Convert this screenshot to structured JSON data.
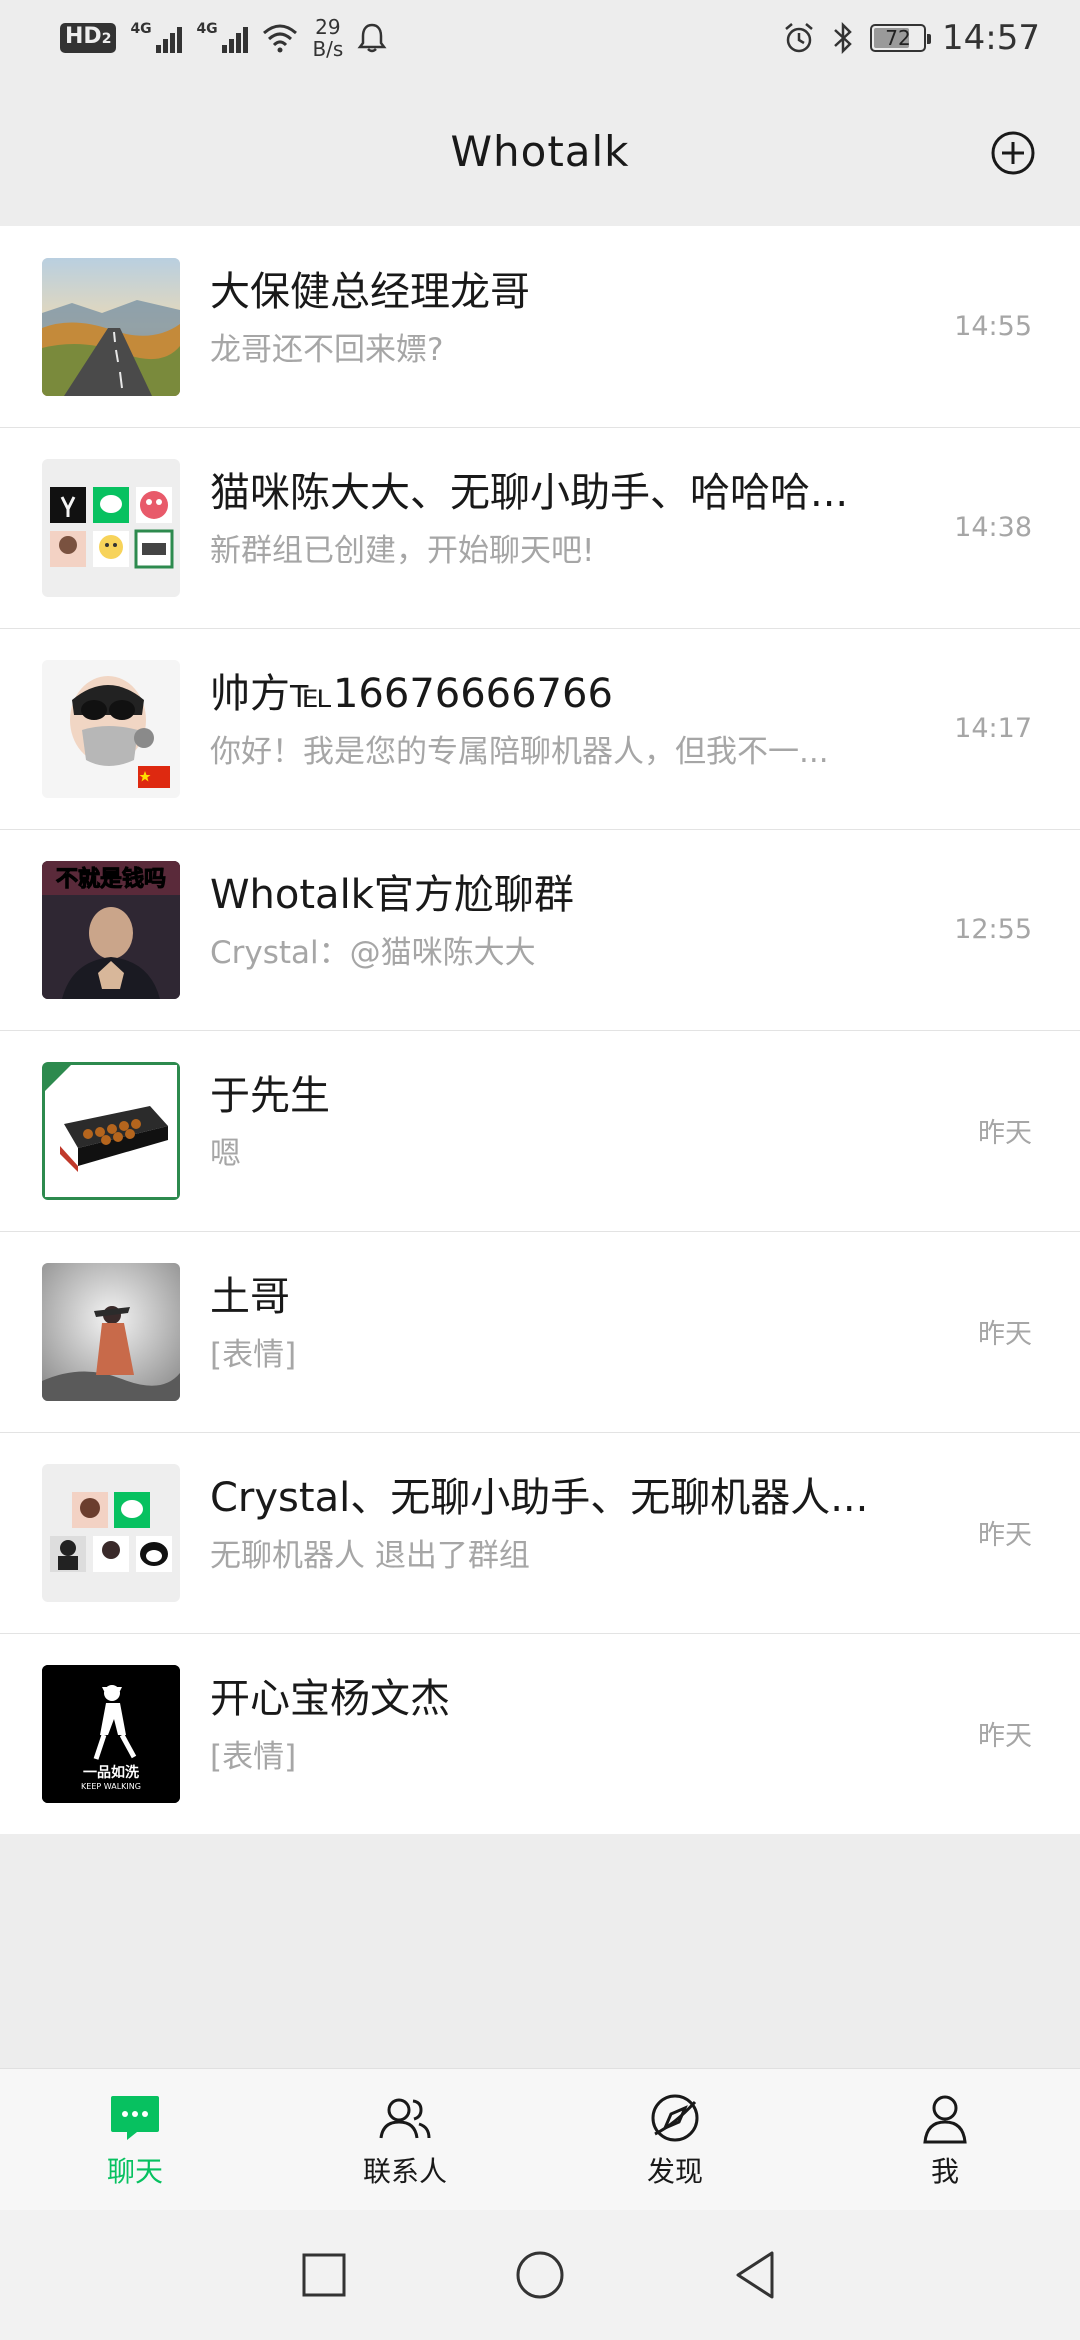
{
  "status_bar": {
    "hd_label": "HD",
    "hd_sub": "2",
    "signal1_gen": "4G",
    "signal2_gen": "4G",
    "speed_value": "29",
    "speed_unit": "B/s",
    "battery_level": "72",
    "time": "14:57"
  },
  "nav": {
    "title": "Whotalk"
  },
  "chats": [
    {
      "name": "大保健总经理龙哥",
      "message": "龙哥还不回来嫖?",
      "time": "14:55"
    },
    {
      "name": "猫咪陈大大、无聊小助手、哈哈哈...",
      "message": "新群组已创建，开始聊天吧!",
      "time": "14:38"
    },
    {
      "name": "帅方℡16676666766",
      "message": "你好！我是您的专属陪聊机器人，但我不一...",
      "time": "14:17"
    },
    {
      "name": "Whotalk官方尬聊群",
      "message": "Crystal：@猫咪陈大大",
      "time": "12:55"
    },
    {
      "name": "于先生",
      "message": "嗯",
      "time": "昨天"
    },
    {
      "name": "土哥",
      "message": "[表情]",
      "time": "昨天"
    },
    {
      "name": "Crystal、无聊小助手、无聊机器人...",
      "message": "无聊机器人 退出了群组",
      "time": "昨天"
    },
    {
      "name": "开心宝杨文杰",
      "message": "[表情]",
      "time": "昨天"
    }
  ],
  "avatar_texts": {
    "chat4_banner": "不就是钱吗",
    "chat8_line1": "一品如洗",
    "chat8_line2": "KEEP WALKING"
  },
  "tabs": [
    {
      "label": "聊天",
      "icon": "chat-bubble-icon",
      "active": true
    },
    {
      "label": "联系人",
      "icon": "contacts-icon",
      "active": false
    },
    {
      "label": "发现",
      "icon": "discover-icon",
      "active": false
    },
    {
      "label": "我",
      "icon": "profile-icon",
      "active": false
    }
  ],
  "colors": {
    "accent": "#07C160",
    "background": "#EDEDED",
    "list_background": "#FFFFFF",
    "primary_text": "#191919",
    "secondary_text": "#A6A6A6"
  }
}
